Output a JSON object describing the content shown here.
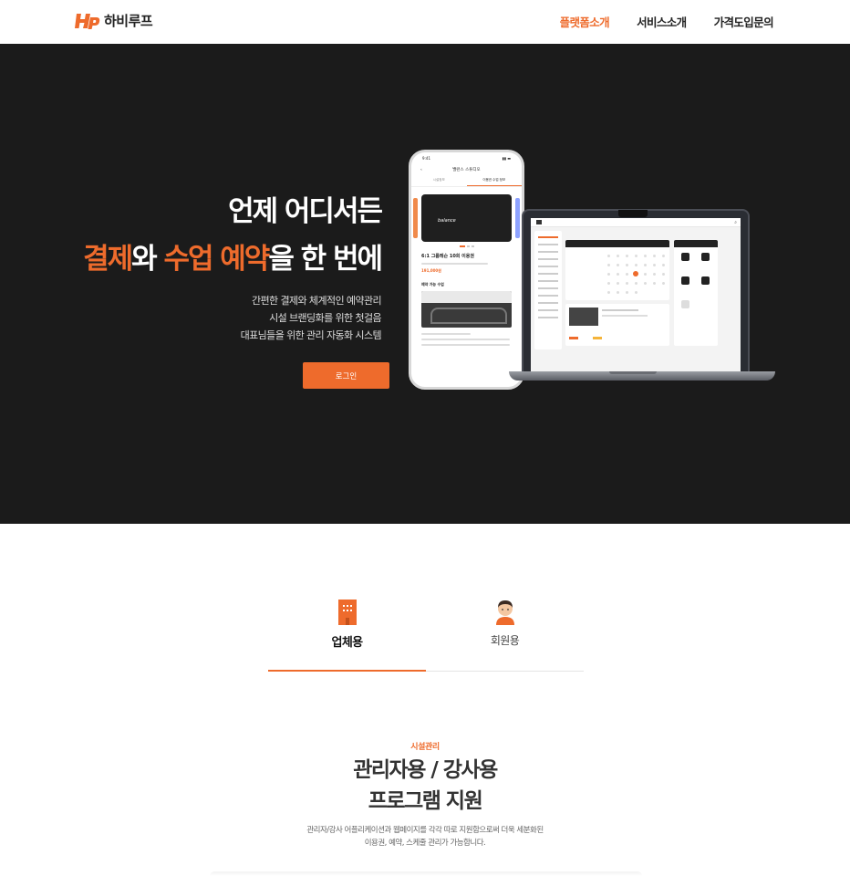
{
  "header": {
    "logo_text": "하비루프",
    "nav": [
      {
        "label": "플랫폼소개",
        "active": true
      },
      {
        "label": "서비스소개",
        "active": false
      },
      {
        "label": "가격도입문의",
        "active": false
      }
    ]
  },
  "hero": {
    "title_line1": "언제 어디서든",
    "title_line2": {
      "part1": "결제",
      "part2": "와 ",
      "part3": "수업 예약",
      "part4": "을 한 번에"
    },
    "subtitle": [
      "간편한 결제와 체계적인 예약관리",
      "시설 브랜딩화를 위한 첫걸음",
      "대표님들을 위한 관리 자동화 시스템"
    ],
    "login_label": "로그인",
    "phone": {
      "time": "9:41",
      "header": "밸런스 스튜디오",
      "tabs": [
        "시설정보",
        "이용권 수업 정보"
      ],
      "card_brand": "balance",
      "pass_title": "6:1 그룹레슨 10회 이용권",
      "price": "191,000원",
      "section": "예약 가능 수업"
    }
  },
  "tabs": [
    {
      "label": "업체용",
      "icon": "building-icon",
      "active": true
    },
    {
      "label": "회원용",
      "icon": "person-icon",
      "active": false
    }
  ],
  "feature": {
    "eyebrow": "시설관리",
    "title_line1": "관리자용 / 강사용",
    "title_line2": "프로그램 지원",
    "desc_line1": "관리자/강사 어플리케이션과 웹페이지를 각각 따로 지원함으로써 더욱 세분화된",
    "desc_line2": "이용권, 예약, 스케줄 관리가 가능합니다."
  },
  "colors": {
    "accent": "#ee6b2c",
    "hero_bg": "#1b1b1b"
  }
}
